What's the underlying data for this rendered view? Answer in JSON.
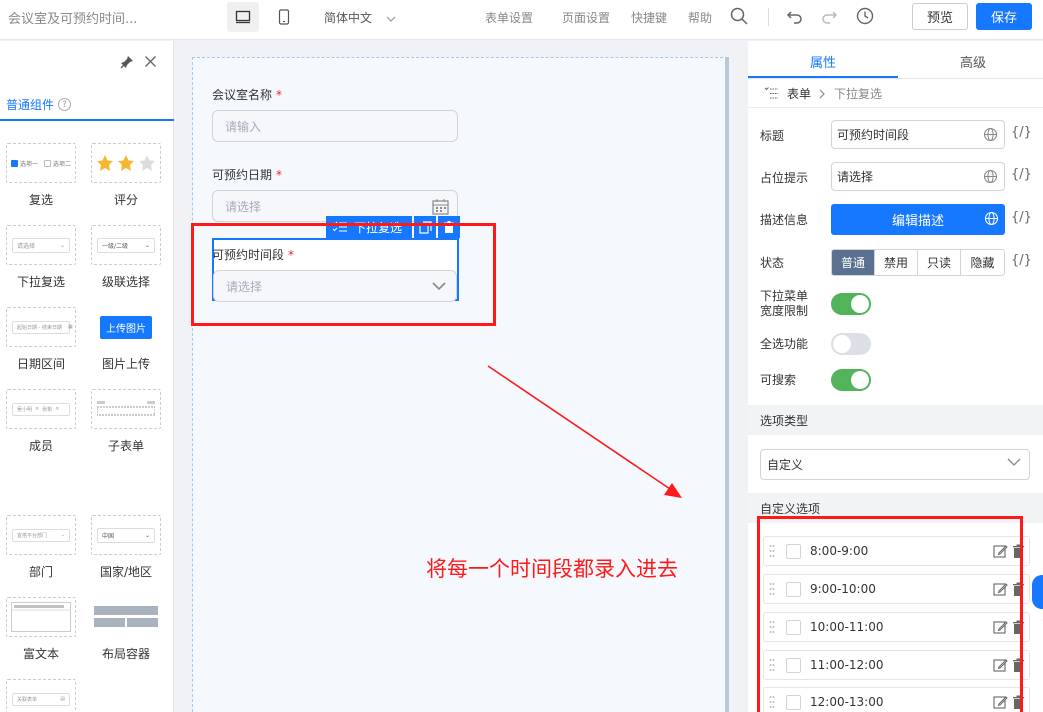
{
  "topbar": {
    "title": "会议室及可预约时间...",
    "language": "简体中文",
    "links": [
      "表单设置",
      "页面设置",
      "快捷键",
      "帮助"
    ],
    "preview_label": "预览",
    "save_label": "保存"
  },
  "left_panel": {
    "tab_label": "普通组件",
    "widgets": [
      {
        "label": "复选",
        "preview": [
          "选项一",
          "选项二"
        ]
      },
      {
        "label": "评分"
      },
      {
        "label": "下拉复选",
        "preview": [
          "请选择"
        ]
      },
      {
        "label": "级联选择",
        "preview": [
          "一级/二级"
        ]
      },
      {
        "label": "日期区间",
        "preview": [
          "起始日期 - 结束日期"
        ]
      },
      {
        "label": "图片上传",
        "preview": [
          "上传图片"
        ]
      },
      {
        "label": "成员",
        "preview": [
          "吴小明",
          "张彬"
        ]
      },
      {
        "label": "子表单"
      },
      {
        "label": "部门",
        "preview": [
          "宜搭平台部门"
        ]
      },
      {
        "label": "国家/地区",
        "preview": [
          "中国"
        ]
      },
      {
        "label": "富文本"
      },
      {
        "label": "布局容器"
      },
      {
        "label": "",
        "preview": [
          "关联表单"
        ]
      }
    ]
  },
  "canvas": {
    "fields": [
      {
        "label": "会议室名称",
        "placeholder": "请输入"
      },
      {
        "label": "可预约日期",
        "placeholder": "请选择"
      },
      {
        "label": "可预约时间段",
        "placeholder": "请选择"
      }
    ],
    "selected_tag": "下拉复选"
  },
  "annotation": {
    "text": "将每一个时间段都录入进去",
    "color": "#ff1a1a"
  },
  "right_panel": {
    "tabs": [
      "属性",
      "高级"
    ],
    "breadcrumb": [
      "表单",
      "下拉复选"
    ],
    "props": {
      "title_label": "标题",
      "title_value": "可预约时间段",
      "placeholder_label": "占位提示",
      "placeholder_value": "请选择",
      "desc_label": "描述信息",
      "desc_button": "编辑描述",
      "state_label": "状态",
      "states": [
        "普通",
        "禁用",
        "只读",
        "隐藏"
      ],
      "dropdown_width_label_1": "下拉菜单",
      "dropdown_width_label_2": "宽度限制",
      "select_all_label": "全选功能",
      "searchable_label": "可搜索",
      "code_glyph": "{/}"
    },
    "toggles": {
      "dropdown_width": true,
      "select_all": false,
      "searchable": true
    },
    "option_type_header": "选项类型",
    "option_type_value": "自定义",
    "custom_options_header": "自定义选项",
    "options": [
      "8:00-9:00",
      "9:00-10:00",
      "10:00-11:00",
      "11:00-12:00",
      "12:00-13:00"
    ]
  },
  "colors": {
    "accent": "#1677ff",
    "toggle_on": "#52b35a",
    "segment_on": "#5b7190"
  }
}
